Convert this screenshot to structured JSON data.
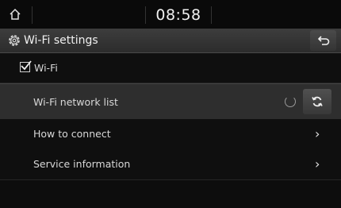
{
  "status_bar": {
    "time": "08:58"
  },
  "header": {
    "title": "Wi-Fi settings"
  },
  "items": {
    "wifi": {
      "label": "Wi-Fi",
      "checked": true
    },
    "network_list": {
      "label": "Wi-Fi network list"
    },
    "how_to_connect": {
      "label": "How to connect"
    },
    "service_info": {
      "label": "Service information"
    }
  },
  "icons": {
    "home": "home-icon",
    "settings": "gear-icon",
    "back": "back-arrow-icon",
    "refresh": "refresh-icon",
    "loading": "loading-spinner-icon",
    "chevron": "chevron-right-icon"
  },
  "colors": {
    "background": "#0d0d0d",
    "header": "#353535",
    "selected_row": "#2e2e2e",
    "text": "#e6e6e6"
  }
}
